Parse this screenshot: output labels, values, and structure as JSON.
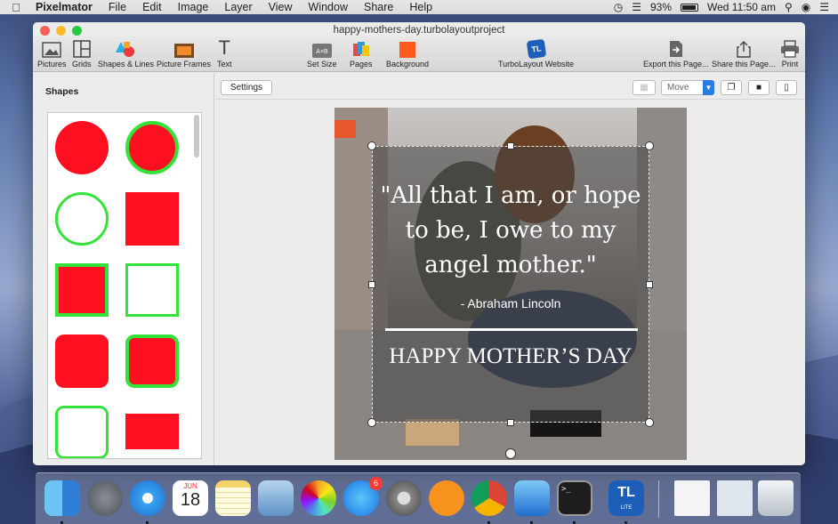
{
  "menubar": {
    "app": "Pixelmator",
    "items": [
      "File",
      "Edit",
      "Image",
      "Layer",
      "View",
      "Window",
      "Share",
      "Help"
    ],
    "battery": "93%",
    "clock": "Wed 11:50 am"
  },
  "window": {
    "title": "happy-mothers-day.turbolayoutproject"
  },
  "toolbar": {
    "pictures": "Pictures",
    "grids": "Grids",
    "shapes_lines": "Shapes & Lines",
    "picture_frames": "Picture Frames",
    "text": "Text",
    "set_size": "Set Size",
    "pages": "Pages",
    "background": "Background",
    "turbolayout_website": "TurboLayout Website",
    "export": "Export this Page...",
    "share": "Share this Page...",
    "print": "Print"
  },
  "sidebar": {
    "title": "Shapes"
  },
  "canvasbar": {
    "settings": "Settings",
    "move": "Move"
  },
  "design": {
    "quote_line1": "\"All that I am, or hope",
    "quote_line2": "to be, I owe to my",
    "quote_line3": "angel mother.\"",
    "author": "- Abraham Lincoln",
    "banner": "HAPPY MOTHER’S DAY"
  },
  "dock": {
    "calendar_month": "JUN",
    "calendar_day": "18",
    "appstore_badge": "6",
    "tl_label": "TL",
    "tl_lite": "LITE"
  },
  "colors": {
    "shape_fill": "#ff1020",
    "shape_stroke": "#34e23a"
  }
}
